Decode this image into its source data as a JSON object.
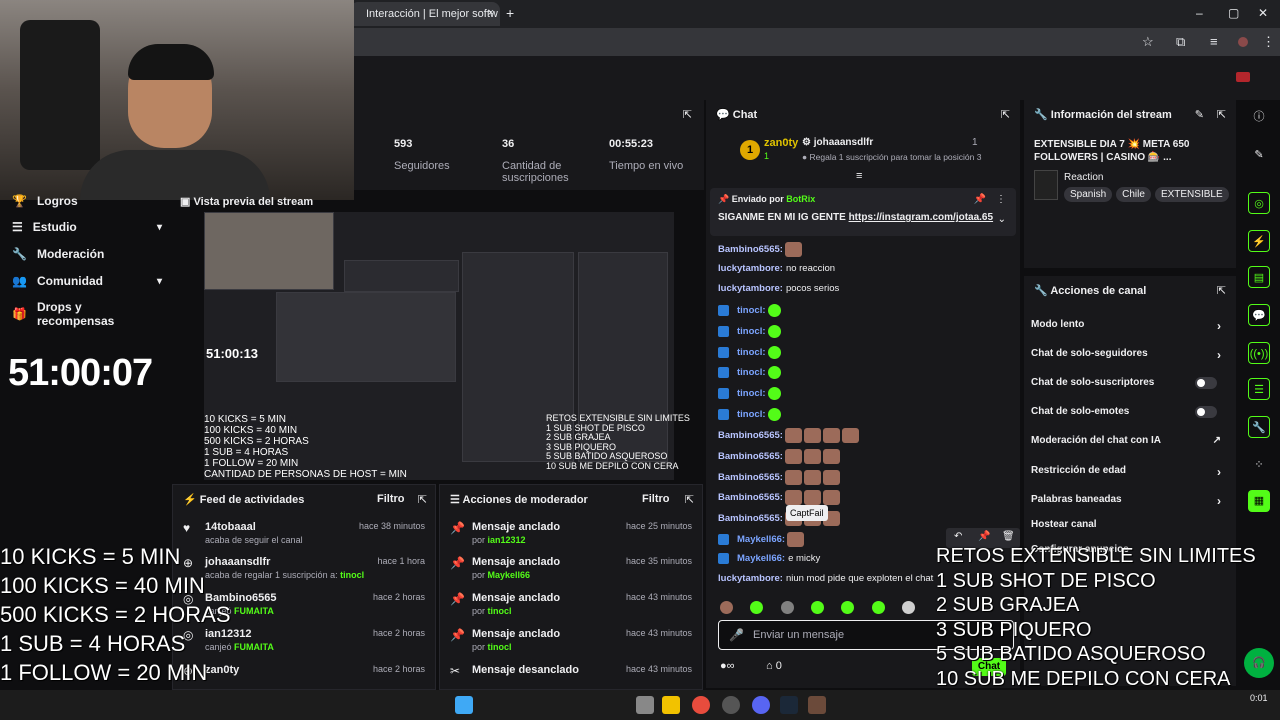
{
  "browser": {
    "tab_title": "Interacción | El mejor softw",
    "tab_close": "×",
    "new_tab": "+",
    "win_min": "–",
    "win_max": "▢",
    "win_close": "✕"
  },
  "sidebar": {
    "items": [
      {
        "label": "Logros"
      },
      {
        "label": "Estudio"
      },
      {
        "label": "Moderación"
      },
      {
        "label": "Comunidad"
      },
      {
        "label": "Drops y recompensas"
      }
    ],
    "timer": "51:00:07"
  },
  "stats": [
    {
      "value": "593",
      "label": "Seguidores"
    },
    {
      "value": "36",
      "label": "Cantidad de suscripciones"
    },
    {
      "value": "00:55:23",
      "label": "Tiempo en vivo"
    }
  ],
  "preview": {
    "title": "Vista previa del stream",
    "timer": "51:00:13",
    "left_text": "10 KICKS = 5 MIN\n100 KICKS = 40 MIN\n500 KICKS = 2 HORAS\n1 SUB = 4 HORAS\n1 FOLLOW = 20 MIN\nCANTIDAD DE PERSONAS DE HOST = MIN",
    "right_text": "RETOS EXTENSIBLE SIN LIMITES\n1 SUB SHOT DE PISCO\n2 SUB GRAJEA\n3 SUB PIQUERO\n5 SUB BATIDO ASQUEROSO\n10 SUB ME DEPILO CON CERA"
  },
  "activity_feed": {
    "title": "Feed de actividades",
    "filter": "Filtro",
    "items": [
      {
        "title": "14tobaaal",
        "sub": "acaba de seguir el canal",
        "time": "hace 38 minutos"
      },
      {
        "title": "johaaansdlfr",
        "sub": "acaba de regalar 1 suscripción a:",
        "highlight": "tinocl",
        "time": "hace 1 hora"
      },
      {
        "title": "Bambino6565",
        "sub": "canjeó",
        "highlight": "FUMAITA",
        "time": "hace 2 horas"
      },
      {
        "title": "ian12312",
        "sub": "canjeó",
        "highlight": "FUMAITA",
        "time": "hace 2 horas"
      },
      {
        "title": "zan0ty",
        "sub": "",
        "time": "hace 2 horas"
      }
    ]
  },
  "mod_actions": {
    "title": "Acciones de moderador",
    "filter": "Filtro",
    "items": [
      {
        "title": "Mensaje anclado",
        "sub": "por",
        "highlight": "ian12312",
        "time": "hace 25 minutos"
      },
      {
        "title": "Mensaje anclado",
        "sub": "por",
        "highlight": "Maykell66",
        "time": "hace 35 minutos"
      },
      {
        "title": "Mensaje anclado",
        "sub": "por",
        "highlight": "tinocl",
        "time": "hace 43 minutos"
      },
      {
        "title": "Mensaje anclado",
        "sub": "por",
        "highlight": "tinocl",
        "time": "hace 43 minutos"
      },
      {
        "title": "Mensaje desanclado",
        "sub": "",
        "time": "hace 43 minutos"
      }
    ]
  },
  "chat": {
    "title": "Chat",
    "top_user": "zan0ty",
    "top_user_count": "1",
    "gifter": "johaaansdlfr",
    "gifter_count": "1",
    "gift_text": "Regala 1 suscripción para tomar la posición 3",
    "pinned_label": "Enviado por",
    "pinned_user": "BotRix",
    "pinned_text": "SIGANME EN MI IG GENTE",
    "pinned_link": "https://instagram.com/jotaa.65",
    "messages": [
      {
        "user": "Bambino6565:",
        "text": "",
        "kind": "face1",
        "badge": false
      },
      {
        "user": "luckytambore:",
        "text": "no reaccion",
        "kind": "text",
        "badge": false
      },
      {
        "user": "luckytambore:",
        "text": "pocos serios",
        "kind": "text",
        "badge": false
      },
      {
        "user": "tinocl:",
        "text": "",
        "kind": "emo",
        "badge": true
      },
      {
        "user": "tinocl:",
        "text": "",
        "kind": "emo",
        "badge": true
      },
      {
        "user": "tinocl:",
        "text": "",
        "kind": "emo",
        "badge": true
      },
      {
        "user": "tinocl:",
        "text": "",
        "kind": "emo",
        "badge": true
      },
      {
        "user": "tinocl:",
        "text": "",
        "kind": "emo",
        "badge": true
      },
      {
        "user": "tinocl:",
        "text": "",
        "kind": "emo",
        "badge": true
      },
      {
        "user": "Bambino6565:",
        "text": "",
        "kind": "face4",
        "badge": false
      },
      {
        "user": "Bambino6565:",
        "text": "",
        "kind": "face3",
        "badge": false
      },
      {
        "user": "Bambino6565:",
        "text": "",
        "kind": "face3",
        "badge": false
      },
      {
        "user": "Bambino6565:",
        "text": "",
        "kind": "face3",
        "badge": false
      },
      {
        "user": "Bambino6565:",
        "text": "",
        "kind": "face3",
        "badge": false
      },
      {
        "user": "Maykell66:",
        "text": "",
        "kind": "face1",
        "badge": true
      },
      {
        "user": "Maykell66:",
        "text": "e micky",
        "kind": "text",
        "badge": true
      },
      {
        "user": "luckytambore:",
        "text": "niun mod pide que exploten el chat",
        "kind": "text",
        "badge": false
      }
    ],
    "tooltip": "CaptFail",
    "input_placeholder": "Enviar un mensaje",
    "send_label": "Chat",
    "footer_count": "0"
  },
  "stream_info": {
    "title": "Información del stream",
    "stream_title": "EXTENSIBLE DIA 7 💥 META 650 FOLLOWERS | CASINO 🎰 ...",
    "category": "Reaction",
    "tags": [
      "Spanish",
      "Chile",
      "EXTENSIBLE"
    ]
  },
  "channel_actions": {
    "title": "Acciones de canal",
    "rows": [
      {
        "label": "Modo lento",
        "control": "chevron"
      },
      {
        "label": "Chat de solo-seguidores",
        "control": "chevron"
      },
      {
        "label": "Chat de solo-suscriptores",
        "control": "toggle"
      },
      {
        "label": "Chat de solo-emotes",
        "control": "toggle"
      },
      {
        "label": "Moderación del chat con IA",
        "control": "link"
      },
      {
        "label": "Restricción de edad",
        "control": "chevron"
      },
      {
        "label": "Palabras baneadas",
        "control": "chevron"
      },
      {
        "label": "Hostear canal",
        "control": "none"
      },
      {
        "label": "Configurar anuncios",
        "control": "none"
      }
    ]
  },
  "overlay_left": [
    "10 KICKS = 5 MIN",
    "100 KICKS = 40 MIN",
    "500 KICKS = 2 HORAS",
    "1 SUB = 4 HORAS",
    " 1 FOLLOW = 20 MIN",
    "CANTIDAD DE PERSONAS DE HOST = MIN"
  ],
  "overlay_right": "RETOS EXTENSIBLE SIN LIMITES\n1 SUB SHOT DE PISCO\n2 SUB GRAJEA\n3 SUB PIQUERO\n5 SUB BATIDO ASQUEROSO\n10 SUB ME DEPILO CON CERA",
  "taskbar": {
    "time": "0:01"
  },
  "colors": {
    "accent": "#53fc18",
    "bg": "#0e0e10",
    "panel": "#18181b"
  }
}
